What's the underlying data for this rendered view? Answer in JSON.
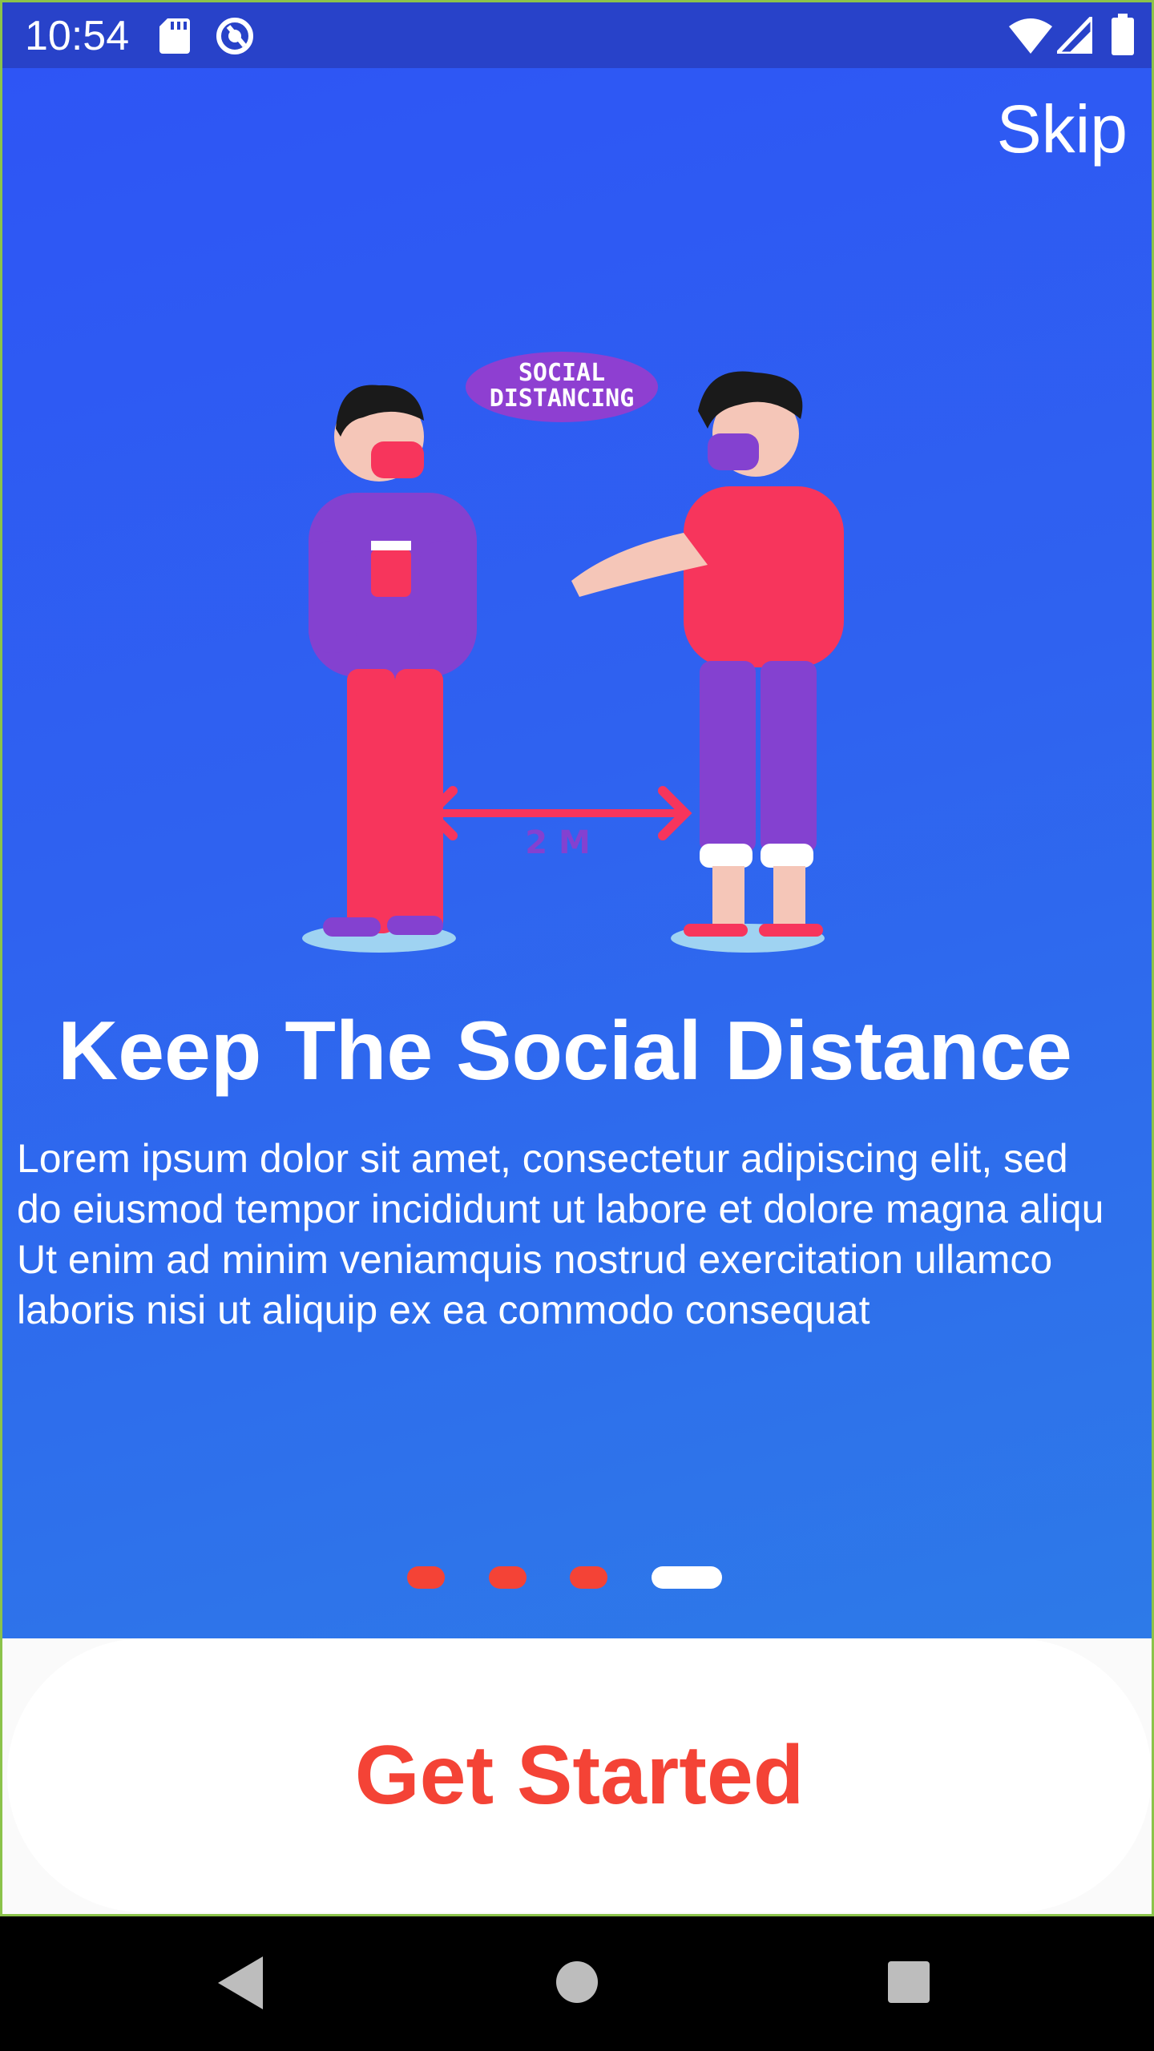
{
  "status_bar": {
    "time": "10:54",
    "icons": [
      "sd-card-icon",
      "sync-icon",
      "wifi-icon",
      "signal-icon",
      "battery-icon"
    ]
  },
  "onboarding": {
    "skip_label": "Skip",
    "illustration": {
      "badge_line1": "SOCIAL",
      "badge_line2": "DISTANCING",
      "distance_label": "2 M"
    },
    "title": "Keep The Social Distance",
    "description": "Lorem ipsum dolor sit amet, consectetur adipiscing elit, sed do eiusmod tempor incididunt ut labore et dolore magna aliqu Ut enim ad minim veniamquis nostrud exercitation ullamco laboris nisi ut aliquip ex ea commodo consequat",
    "pager": {
      "total": 4,
      "current": 4
    },
    "cta_label": "Get Started"
  },
  "colors": {
    "status_bar": "#2842C9",
    "hero_gradient_start": "#2E55F5",
    "hero_gradient_end": "#2D7AE8",
    "accent": "#F44336",
    "button_bg": "#FFFFFF"
  },
  "nav_bar": {
    "icons": [
      "back-icon",
      "home-icon",
      "recents-icon"
    ]
  }
}
